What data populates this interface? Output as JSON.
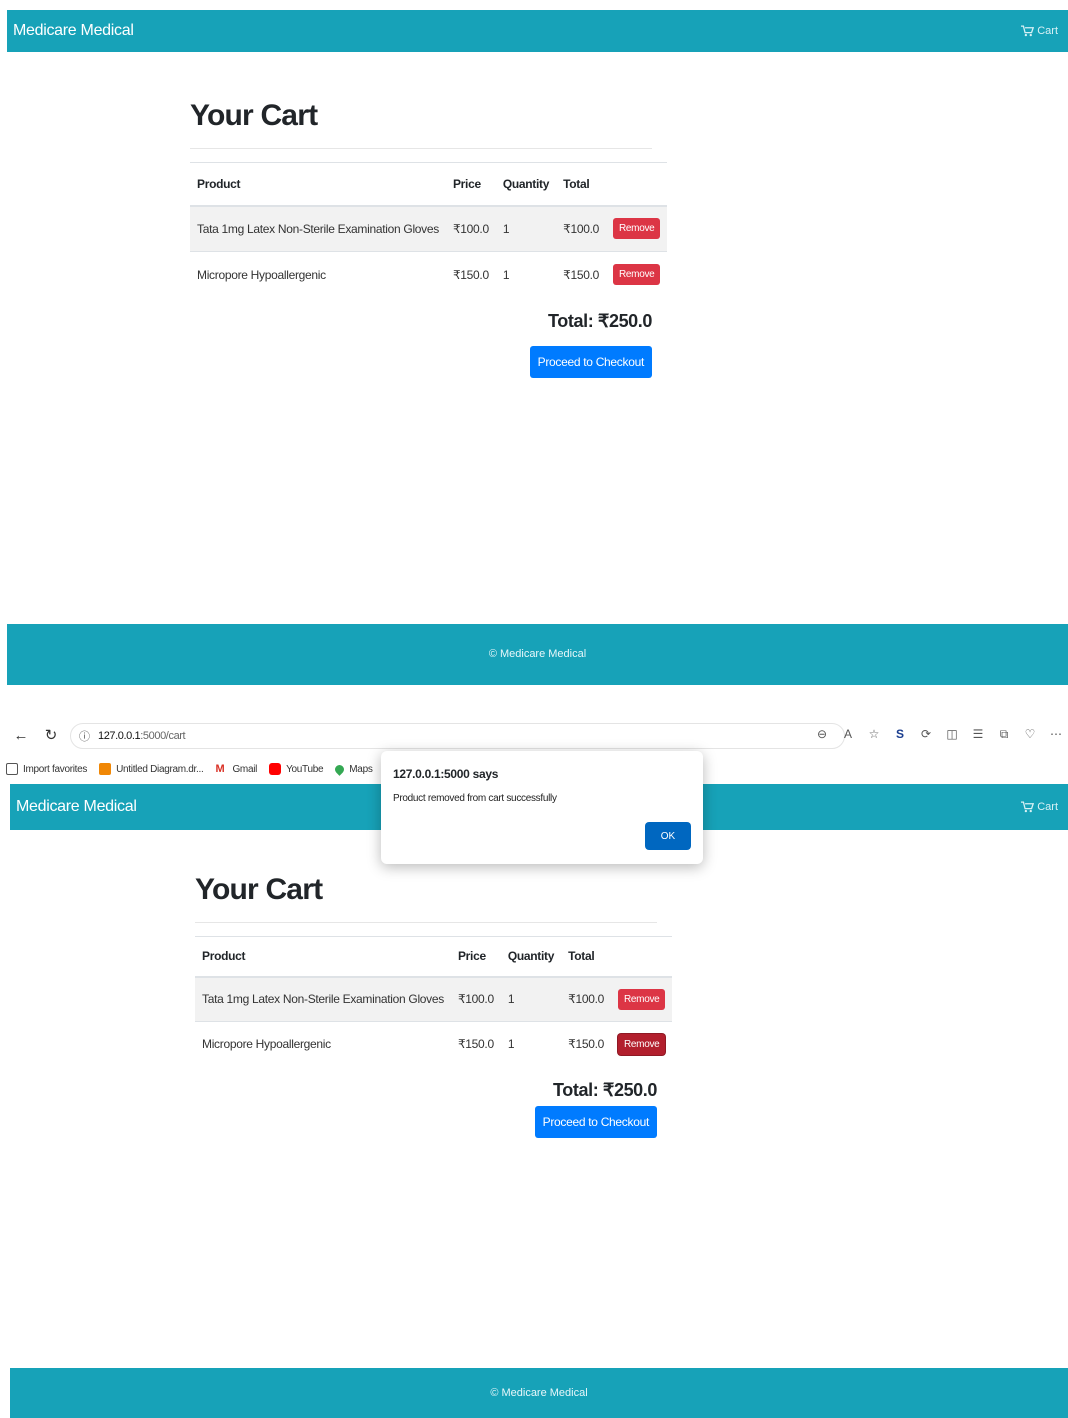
{
  "site": {
    "brand": "Medicare Medical",
    "nav_cart_label": "Cart",
    "footer": "© Medicare Medical",
    "colors": {
      "navbar": "#17a2b8",
      "remove": "#dc3545",
      "checkout": "#007bff"
    }
  },
  "cart": {
    "heading": "Your Cart",
    "columns": [
      "Product",
      "Price",
      "Quantity",
      "Total"
    ],
    "rows": [
      {
        "product": "Tata 1mg Latex Non-Sterile Examination Gloves",
        "price": "₹100.0",
        "quantity": "1",
        "total": "₹100.0",
        "action": "Remove"
      },
      {
        "product": "Micropore Hypoallergenic",
        "price": "₹150.0",
        "quantity": "1",
        "total": "₹150.0",
        "action": "Remove"
      }
    ],
    "grand_total": "Total: ₹250.0",
    "checkout_label": "Proceed to Checkout"
  },
  "browser": {
    "url_host": "127.0.0.1",
    "url_rest": ":5000/cart",
    "bookmarks": [
      "Import favorites",
      "Untitled Diagram.dr...",
      "Gmail",
      "YouTube",
      "Maps"
    ]
  },
  "dialog": {
    "title": "127.0.0.1:5000 says",
    "message": "Product removed from cart successfully",
    "ok_label": "OK"
  }
}
